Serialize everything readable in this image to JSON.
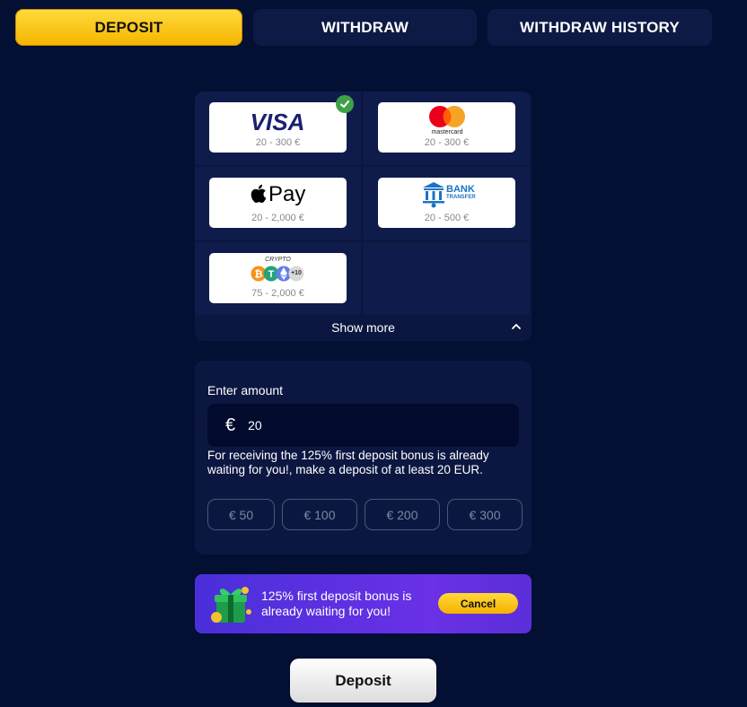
{
  "tabs": {
    "deposit": "DEPOSIT",
    "withdraw": "WITHDRAW",
    "history": "WITHDRAW HISTORY"
  },
  "methods": [
    {
      "name": "VISA",
      "range": "20 - 300 €",
      "selected": true
    },
    {
      "name": "mastercard",
      "range": "20 - 300 €",
      "selected": false
    },
    {
      "name": "Pay",
      "range": "20 - 2,000 €",
      "selected": false
    },
    {
      "name_line1": "BANK",
      "name_line2": "TRANSFER",
      "range": "20 - 500 €",
      "selected": false
    },
    {
      "name": "CRYPTO",
      "extra": "+10",
      "range": "75 - 2,000 €",
      "selected": false
    }
  ],
  "show_more": "Show more",
  "amount": {
    "label": "Enter amount",
    "currency": "€",
    "value": "20",
    "note": "For receiving the 125% first deposit bonus is already waiting for you!, make a deposit of at least 20 EUR.",
    "presets": [
      "€ 50",
      "€ 100",
      "€ 200",
      "€ 300"
    ]
  },
  "banner": {
    "text": "125% first deposit bonus is already waiting for you!",
    "cancel": "Cancel"
  },
  "deposit_button": "Deposit",
  "colors": {
    "background": "#030f33",
    "accent": "#f5b400",
    "banner": "#5b2ed8",
    "check": "#3fa048"
  }
}
